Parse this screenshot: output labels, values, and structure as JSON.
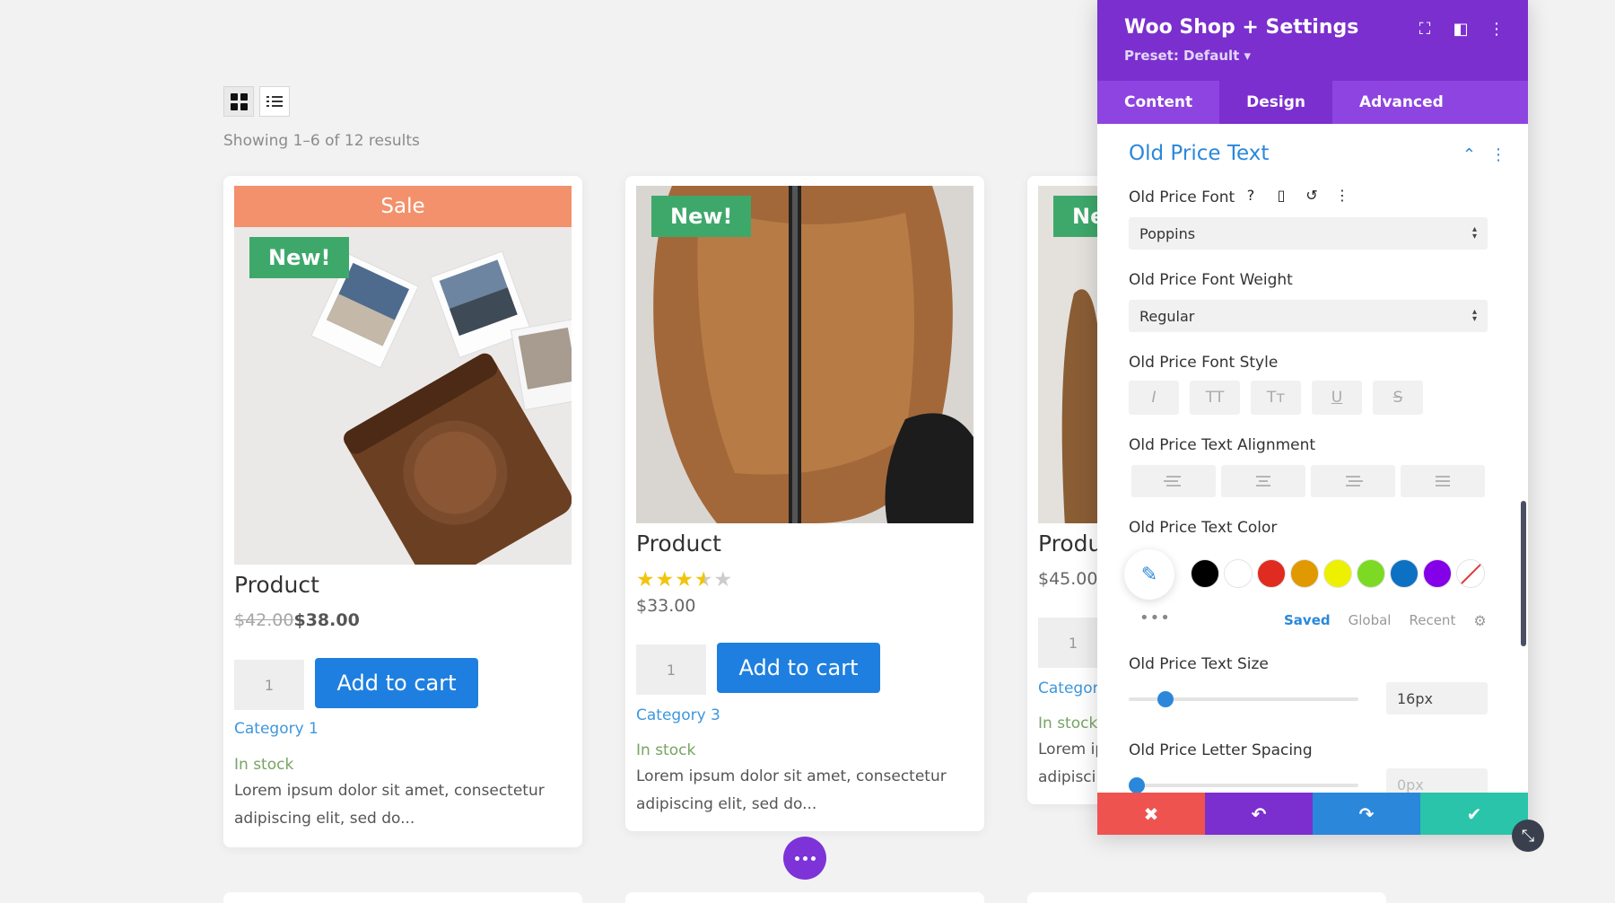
{
  "shop": {
    "results_text": "Showing 1–6 of 12 results",
    "view_grid_icon": "grid-view-icon",
    "view_list_icon": "list-view-icon",
    "products": [
      {
        "title": "Product",
        "sale_label": "Sale",
        "badge": "New!",
        "old_price": "$42.00",
        "price": "$38.00",
        "qty": "1",
        "add_to_cart": "Add to cart",
        "category": "Category 1",
        "stock": "In stock",
        "description": "Lorem ipsum dolor sit amet, consectetur adipiscing elit, sed do..."
      },
      {
        "title": "Product",
        "badge": "New!",
        "rating": 3.5,
        "price": "$33.00",
        "qty": "1",
        "add_to_cart": "Add to cart",
        "category": "Category 3",
        "stock": "In stock",
        "description": "Lorem ipsum dolor sit amet, consectetur adipiscing elit, sed do..."
      },
      {
        "title": "Produ",
        "badge": "Ne",
        "price": "$45.00",
        "qty": "1",
        "category": "Categor",
        "stock": "In stock",
        "description_line1": "Lorem ip",
        "description_line2": "adipisci"
      }
    ]
  },
  "panel": {
    "title": "Woo Shop + Settings",
    "preset": "Preset: Default ▾",
    "tabs": [
      "Content",
      "Design",
      "Advanced"
    ],
    "active_tab": "Design",
    "section_title": "Old Price Text",
    "font_label": "Old Price Font",
    "font_value": "Poppins",
    "weight_label": "Old Price Font Weight",
    "weight_value": "Regular",
    "style_label": "Old Price Font Style",
    "style_buttons": [
      "I",
      "TT",
      "Tт",
      "U",
      "S"
    ],
    "alignment_label": "Old Price Text Alignment",
    "color_label": "Old Price Text Color",
    "color_swatches": [
      "#000000",
      "#ffffff",
      "#e02b20",
      "#e09900",
      "#edf000",
      "#7cda24",
      "#0c71c3",
      "#8300e9"
    ],
    "color_tabs": [
      "Saved",
      "Global",
      "Recent"
    ],
    "active_color_tab": "Saved",
    "size_label": "Old Price Text Size",
    "size_value": "16px",
    "size_slider_fraction": 0.16,
    "spacing_label": "Old Price Letter Spacing",
    "spacing_value": "0px",
    "spacing_slider_fraction": 0.0
  },
  "colors": {
    "accent_purple": "#7b2fcf",
    "button_blue": "#1e7fe0",
    "new_badge_green": "#3ea86b",
    "sale_orange": "#f2916b",
    "link_blue": "#3e97dd",
    "stock_green": "#77a464"
  }
}
